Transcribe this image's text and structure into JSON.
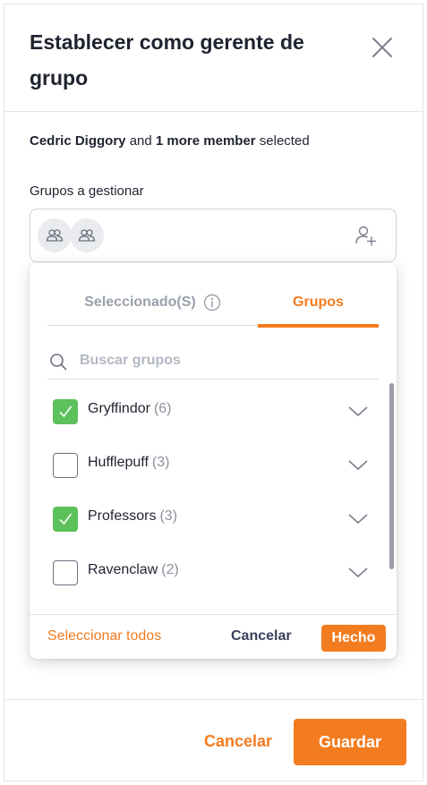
{
  "dialog": {
    "title": "Establecer como gerente de grupo"
  },
  "selection": {
    "primary_name": "Cedric Diggory",
    "connector": " and ",
    "more_count": "1 more member",
    "suffix": " selected"
  },
  "groups_field": {
    "label": "Grupos a gestionar",
    "chips": [
      "group-icon",
      "group-icon"
    ]
  },
  "dropdown": {
    "tabs": {
      "selected_label": "Seleccionado(S)",
      "groups_label": "Grupos",
      "active": "Grupos"
    },
    "search": {
      "placeholder": "Buscar grupos",
      "value": ""
    },
    "items": [
      {
        "name": "Gryffindor",
        "count": "(6)",
        "checked": true
      },
      {
        "name": "Hufflepuff",
        "count": "(3)",
        "checked": false
      },
      {
        "name": "Professors",
        "count": "(3)",
        "checked": true
      },
      {
        "name": "Ravenclaw",
        "count": "(2)",
        "checked": false
      }
    ],
    "footer": {
      "select_all_label": "Seleccionar todos",
      "cancel_label": "Cancelar",
      "done_label": "Hecho"
    }
  },
  "footer": {
    "cancel_label": "Cancelar",
    "save_label": "Guardar"
  },
  "colors": {
    "accent": "#f47c20",
    "checked": "#5cc15a",
    "text": "#1f2330",
    "muted": "#9aa0ab"
  }
}
